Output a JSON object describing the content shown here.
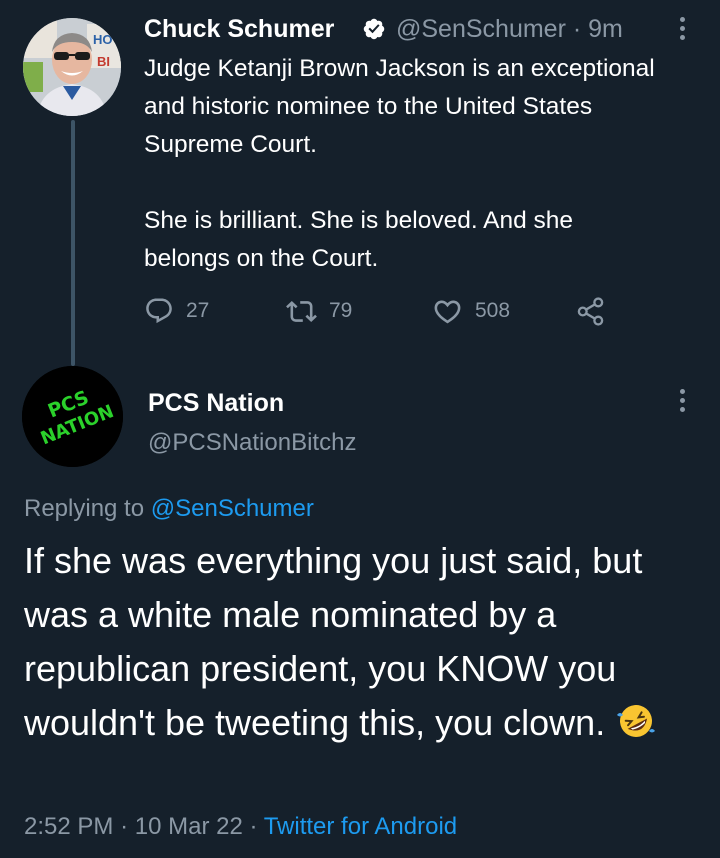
{
  "tweet1": {
    "author_name": "Chuck Schumer",
    "handle": "@SenSchumer",
    "separator": "·",
    "time": "9m",
    "verified_icon": "verified-badge-icon",
    "paragraph1": "Judge Ketanji Brown Jackson is an exceptional and historic nominee to the United States Supreme Court.",
    "paragraph2": "She is brilliant. She is beloved. And she belongs on the Court.",
    "actions": {
      "reply_count": "27",
      "retweet_count": "79",
      "like_count": "508"
    },
    "avatar_sign_text": "HO BI"
  },
  "tweet2": {
    "author_name": "PCS Nation",
    "handle": "@PCSNationBitchz",
    "avatar_logo_text": "PCS NATION",
    "replying_prefix": "Replying to",
    "replying_handle": "@SenSchumer",
    "text": "If she was everything you just said, but was a white male nominated by a republican president, you KNOW you wouldn't be tweeting this, you clown.",
    "emoji": "rolling-on-floor-laughing-emoji",
    "time": "2:52 PM",
    "separator": "·",
    "date": "10 Mar 22",
    "separator2": "·",
    "source": "Twitter for Android"
  },
  "colors": {
    "background": "#15202b",
    "text_primary": "#ffffff",
    "text_secondary": "#8b98a5",
    "accent": "#1d9bf0",
    "thread_line": "#3d5466",
    "logo_green": "#2bd12b"
  }
}
